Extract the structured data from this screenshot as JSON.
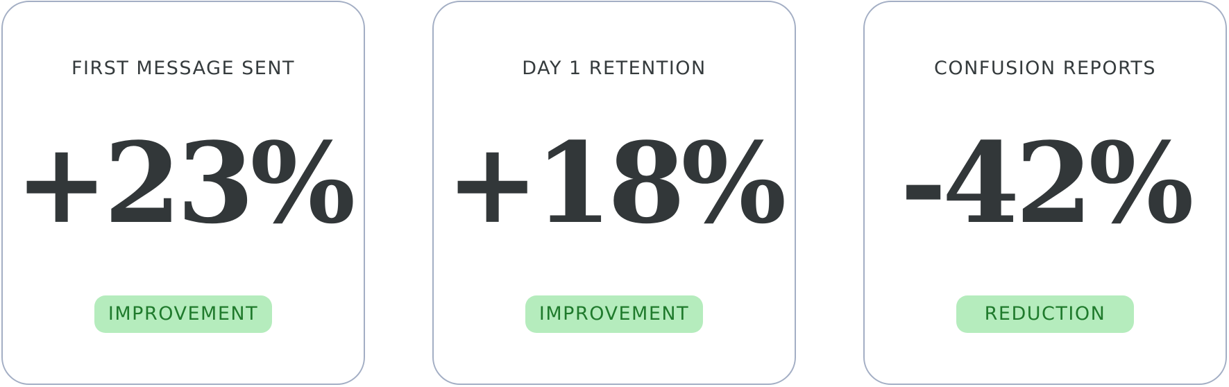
{
  "cards": [
    {
      "label": "FIRST MESSAGE SENT",
      "value": "+23%",
      "badge": "IMPROVEMENT"
    },
    {
      "label": "DAY 1 RETENTION",
      "value": "+18%",
      "badge": "IMPROVEMENT"
    },
    {
      "label": "CONFUSION REPORTS",
      "value": "-42%",
      "badge": "REDUCTION"
    }
  ],
  "colors": {
    "card_border": "#a3aec4",
    "text_dark": "#323739",
    "badge_bg": "#b5ecbd",
    "badge_text": "#1f7a2c"
  }
}
